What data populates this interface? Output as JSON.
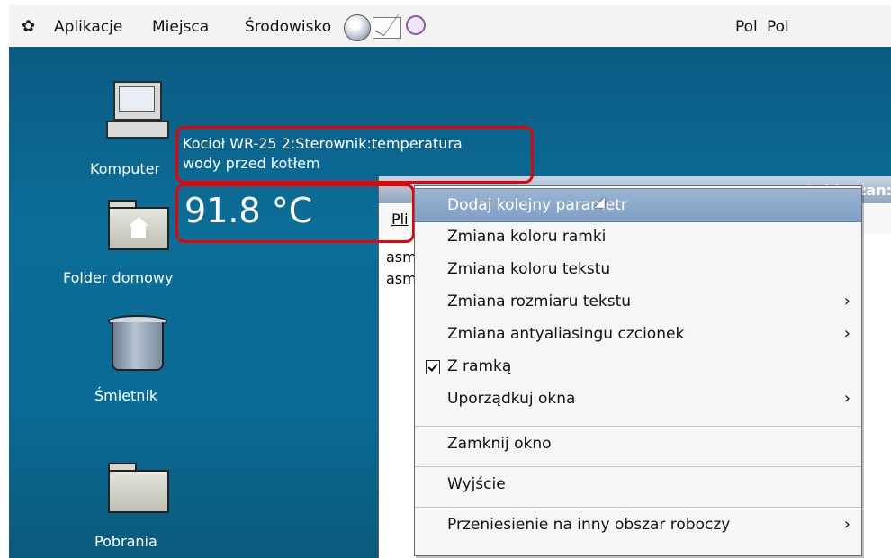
{
  "panel": {
    "menu": [
      "Aplikacje",
      "Miejsca",
      "Środowisko"
    ],
    "keyboard": [
      "Pol",
      "Pol"
    ],
    "icons": [
      "gnome-foot-icon",
      "globe-icon",
      "mail-icon",
      "clock-icon"
    ]
  },
  "desktop": {
    "icons": [
      {
        "label": "Komputer",
        "icon": "computer-icon"
      },
      {
        "label": "Folder domowy",
        "icon": "home-folder-icon"
      },
      {
        "label": "Śmietnik",
        "icon": "trash-icon"
      },
      {
        "label": "Pobrania",
        "icon": "folder-icon"
      }
    ]
  },
  "widget": {
    "line1": "Kocioł WR-25 2:Sterownik:temperatura",
    "line2": "wody przed kotłem",
    "value": "91.8 °C",
    "frame_color": "#e00000"
  },
  "window": {
    "title": "Sobieszan:",
    "menu_first": "Pli",
    "lines": [
      "asm",
      "asm"
    ]
  },
  "context_menu": {
    "items": [
      {
        "label": "Dodaj kolejny parametr",
        "submenu": false,
        "highlight": true
      },
      {
        "label": "Zmiana koloru ramki",
        "submenu": false
      },
      {
        "label": "Zmiana koloru tekstu",
        "submenu": false
      },
      {
        "label": "Zmiana rozmiaru tekstu",
        "submenu": true
      },
      {
        "label": "Zmiana antyaliasingu czcionek",
        "submenu": true
      },
      {
        "label": "Z ramką",
        "submenu": false,
        "checked": true
      },
      {
        "label": "Uporządkuj okna",
        "submenu": true
      },
      {
        "label": "Zamknij okno",
        "submenu": false
      },
      {
        "label": "Wyjście",
        "submenu": false
      },
      {
        "label": "Przeniesienie na inny obszar roboczy",
        "submenu": true
      }
    ],
    "arrow": "›"
  }
}
